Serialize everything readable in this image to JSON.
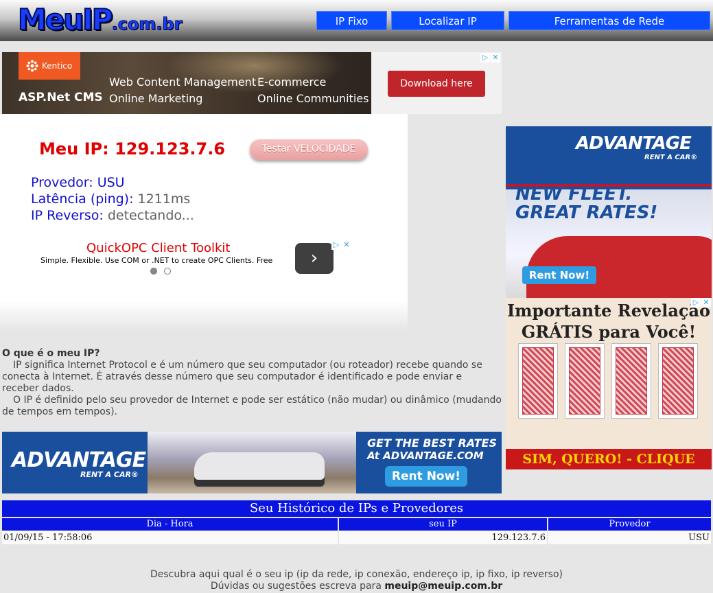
{
  "header": {
    "logo_main": "MeuIP",
    "logo_suffix": ".com.br",
    "nav": [
      "IP Fixo",
      "Localizar IP",
      "Ferramentas de Rede"
    ]
  },
  "ad_top": {
    "brand": "Kentico",
    "product": "ASP.Net CMS",
    "features": [
      "Web Content Management",
      "Online Marketing",
      "E-commerce",
      "Online Communities"
    ],
    "cta": "Download here"
  },
  "ip_panel": {
    "my_ip_label": "Meu IP:",
    "my_ip_value": "129.123.7.6",
    "speed_button": "Testar VELOCIDADE",
    "provider_label": "Provedor:",
    "provider_value": "USU",
    "latency_label": "Latência (ping):",
    "latency_value": "1211ms",
    "reverse_label": "IP Reverso:",
    "reverse_value": "detectando..."
  },
  "ad_opc": {
    "title": "QuickOPC Client Toolkit",
    "subtitle": "Simple. Flexible. Use COM or .NET to create OPC Clients. Free",
    "next": "›"
  },
  "about": {
    "heading": "O que é o meu IP?",
    "p1": "IP significa Internet Protocol e é um número que seu computador (ou roteador) recebe quando se conecta à Internet. É através desse número que seu computador é identificado e pode enviar e receber dados.",
    "p2": "O IP é definido pelo seu provedor de Internet e pode ser estático (não mudar) ou dinâmico (mudando de tempos em tempos)."
  },
  "ad_right1": {
    "brand": "ADVANTAGE",
    "brand_sub": "RENT A CAR®",
    "headline1": "NEW FLEET.",
    "headline2": "GREAT RATES!",
    "cta": "Rent Now!"
  },
  "ad_right2": {
    "headline1": "Importante Revelação",
    "headline2": "GRÁTIS para Você!",
    "cta": "SIM, QUERO! - CLIQUE AGORA"
  },
  "ad_bottom": {
    "brand": "ADVANTAGE",
    "brand_sub": "RENT A CAR®",
    "line1": "GET THE BEST RATES",
    "line2": "At ADVANTAGE.COM",
    "cta": "Rent Now!"
  },
  "history": {
    "title": "Seu Histórico de IPs e Provedores",
    "columns": [
      "Dia - Hora",
      "seu IP",
      "Provedor"
    ],
    "rows": [
      [
        "01/09/15 - 17:58:06",
        "129.123.7.6",
        "USU"
      ]
    ]
  },
  "footer": {
    "line1": "Descubra aqui qual é o seu ip (ip da rede, ip conexão, endereço ip, ip fixo, ip reverso)",
    "line2_prefix": "Dúvidas ou sugestões escreva para",
    "email": "meuip@meuip.com.br"
  },
  "colors": {
    "nav_blue": "#0a4cff",
    "ip_red": "#e00000",
    "label_blue": "#1010cc",
    "table_blue": "#0a14e0"
  }
}
